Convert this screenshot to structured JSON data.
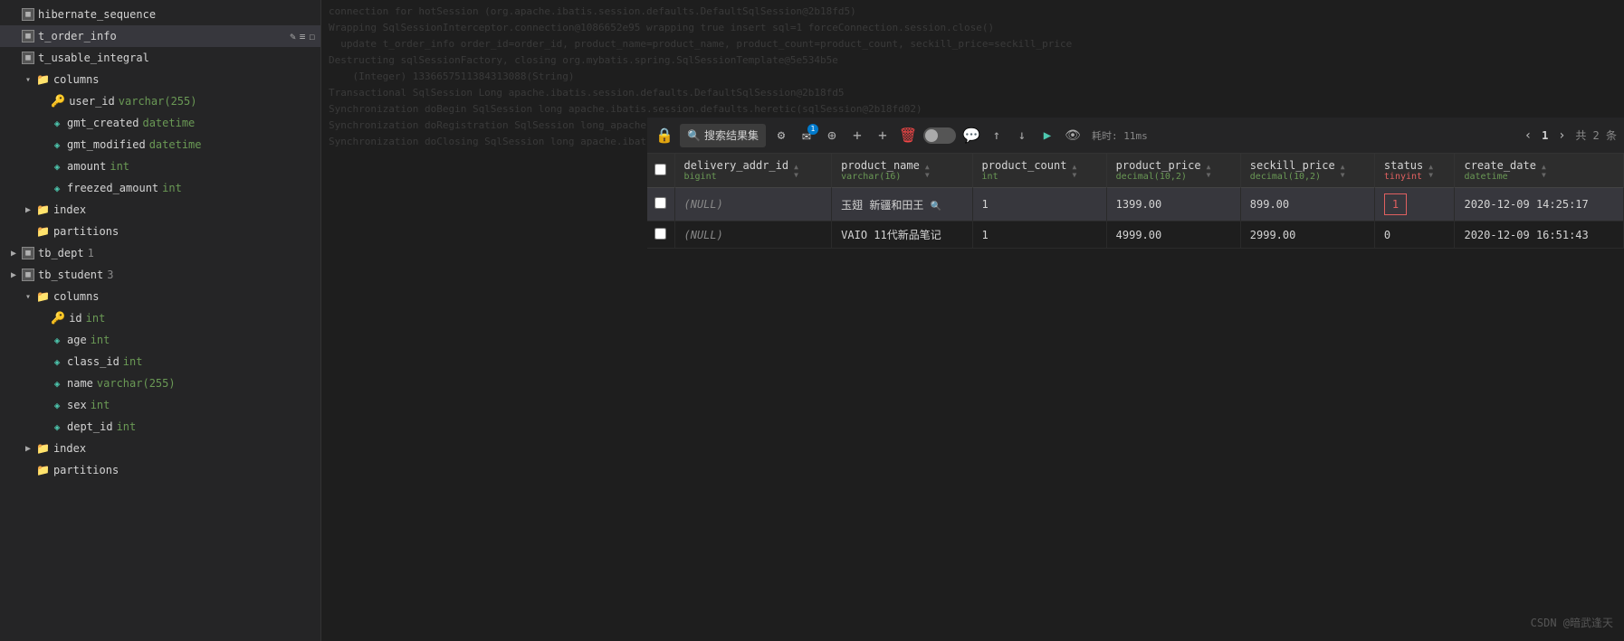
{
  "sidebar": {
    "items": [
      {
        "id": "hibernate_sequence",
        "label": "hibernate_sequence",
        "type": "table",
        "indent": 1,
        "hasChevron": false
      },
      {
        "id": "t_order_info",
        "label": "t_order_info",
        "type": "table",
        "indent": 1,
        "selected": true,
        "hasChevron": false,
        "editable": true
      },
      {
        "id": "t_usable_integral",
        "label": "t_usable_integral",
        "type": "table",
        "indent": 1,
        "hasChevron": false
      },
      {
        "id": "columns_group",
        "label": "columns",
        "type": "folder",
        "indent": 2,
        "expanded": true,
        "hasChevron": true
      },
      {
        "id": "col_user_id",
        "label": "user_id",
        "type": "key",
        "subtype": "varchar(255)",
        "indent": 3
      },
      {
        "id": "col_gmt_created",
        "label": "gmt_created",
        "type": "col",
        "subtype": "datetime",
        "indent": 3
      },
      {
        "id": "col_gmt_modified",
        "label": "gmt_modified",
        "type": "col",
        "subtype": "datetime",
        "indent": 3
      },
      {
        "id": "col_amount",
        "label": "amount",
        "type": "col",
        "subtype": "int",
        "indent": 3
      },
      {
        "id": "col_freezed_amount",
        "label": "freezed_amount",
        "type": "col",
        "subtype": "int",
        "indent": 3
      },
      {
        "id": "index_group",
        "label": "index",
        "type": "folder",
        "indent": 2,
        "expanded": false,
        "hasChevron": true
      },
      {
        "id": "partitions_group1",
        "label": "partitions",
        "type": "folder",
        "indent": 2,
        "expanded": false,
        "hasChevron": false
      },
      {
        "id": "tb_dept",
        "label": "tb_dept",
        "type": "table",
        "indent": 1,
        "count": 1,
        "hasChevron": false
      },
      {
        "id": "tb_student",
        "label": "tb_student",
        "type": "table",
        "indent": 1,
        "count": 3,
        "hasChevron": false
      },
      {
        "id": "columns_group2",
        "label": "columns",
        "type": "folder",
        "indent": 2,
        "expanded": true,
        "hasChevron": true
      },
      {
        "id": "col2_id",
        "label": "id",
        "type": "key",
        "subtype": "int",
        "indent": 3
      },
      {
        "id": "col2_age",
        "label": "age",
        "type": "col",
        "subtype": "int",
        "indent": 3
      },
      {
        "id": "col2_class_id",
        "label": "class_id",
        "type": "col",
        "subtype": "int",
        "indent": 3
      },
      {
        "id": "col2_name",
        "label": "name",
        "type": "col",
        "subtype": "varchar(255)",
        "indent": 3
      },
      {
        "id": "col2_sex",
        "label": "sex",
        "type": "col",
        "subtype": "int",
        "indent": 3
      },
      {
        "id": "col2_dept_id",
        "label": "dept_id",
        "type": "col",
        "subtype": "int",
        "indent": 3
      },
      {
        "id": "index_group2",
        "label": "index",
        "type": "folder",
        "indent": 2,
        "expanded": false,
        "hasChevron": true
      },
      {
        "id": "partitions_group2",
        "label": "partitions",
        "type": "folder",
        "indent": 2,
        "expanded": false,
        "hasChevron": false
      }
    ]
  },
  "toolbar": {
    "search_placeholder": "搜索结果集",
    "notification_count": "1",
    "timing_label": "耗时: 11ms",
    "page_current": "1",
    "page_total_label": "共 2 条"
  },
  "log_bg_text": "connection for hotSession (org.apache.ibatis.session.defaults.DefaultSqlSession@2b18fd5)\nWrapping SqlSessionInterceptor.connection@1086652e95 wrapping true insert sql=1 forceConnection.session.close()\n  update t_order_info order_id=order_id, product_name=product_name, product_count=product_count, seckill_price=seckill_price\nDestructing sqlSessionFactory, closing org.mybatis.spring.SqlSessionTemplate@5e534b5e\n    (Integer) 1336657511384313088(String)\nTransactional SqlSession Long apache.ibatis.session.defaults.DefaultSqlSession@2b18fd5\nSynchronization doBegin SqlSession long apache.ibatis.session.defaults.heretic(sqlSession@2b18fd02)\nSynchronization doRegistration SqlSession long_apache.ibatis.session.defaults.heretic(sqlSession@2b18fd03)\nSynchronization doClosing SqlSession long apache.ibatis.session.defaults.heretic(sqlSession@2b18fd04)",
  "table": {
    "columns": [
      {
        "name": "delivery_addr_id",
        "type": "bigint"
      },
      {
        "name": "product_name",
        "type": "varchar(16)"
      },
      {
        "name": "product_count",
        "type": "int"
      },
      {
        "name": "product_price",
        "type": "decimal(10,2)"
      },
      {
        "name": "seckill_price",
        "type": "decimal(10,2)"
      },
      {
        "name": "status",
        "type": "tinyint"
      },
      {
        "name": "create_date",
        "type": "datetime"
      }
    ],
    "rows": [
      {
        "delivery_addr_id": "(NULL)",
        "product_name": "玉翅 新疆和田王",
        "product_count": "1",
        "product_price": "1399.00",
        "seckill_price": "899.00",
        "status": "1",
        "create_date": "2020-12-09 14:25:17",
        "status_highlighted": true
      },
      {
        "delivery_addr_id": "(NULL)",
        "product_name": "VAIO 11代新品笔记",
        "product_count": "1",
        "product_price": "4999.00",
        "seckill_price": "2999.00",
        "status": "0",
        "create_date": "2020-12-09 16:51:43",
        "status_highlighted": false
      }
    ]
  },
  "watermark": "CSDN @暗武逢天"
}
